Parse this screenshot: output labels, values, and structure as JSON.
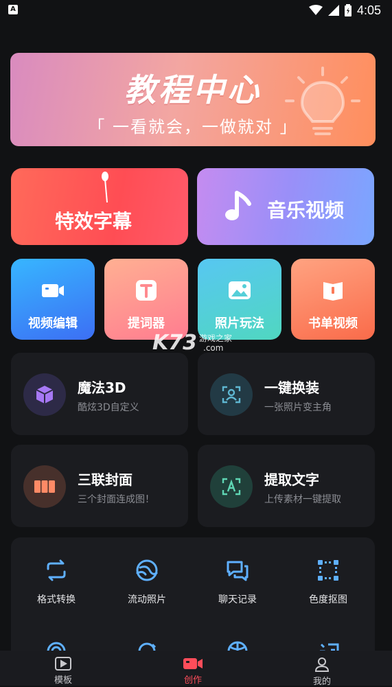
{
  "status_bar": {
    "time": "4:05",
    "app_badge": "A"
  },
  "banner": {
    "title": "教程中心",
    "subtitle": "「 一看就会，一做就对 」"
  },
  "big_cards": [
    {
      "label": "特效字幕"
    },
    {
      "label": "音乐视频"
    }
  ],
  "quick_cards": [
    {
      "label": "视频编辑",
      "icon": "video-camera-icon"
    },
    {
      "label": "提词器",
      "icon": "teleprompter-t-icon"
    },
    {
      "label": "照片玩法",
      "icon": "photo-icon"
    },
    {
      "label": "书单视频",
      "icon": "book-icon"
    }
  ],
  "feature_tiles": [
    {
      "title": "魔法3D",
      "subtitle": "酷炫3D自定义",
      "icon": "cube-icon",
      "accent": "#9a6cf0"
    },
    {
      "title": "一键换装",
      "subtitle": "一张照片变主角",
      "icon": "face-scan-icon",
      "accent": "#4fa6c2"
    },
    {
      "title": "三联封面",
      "subtitle": "三个封面连成图！",
      "icon": "triptych-icon",
      "accent": "#ff7a5a"
    },
    {
      "title": "提取文字",
      "subtitle": "上传素材一键提取",
      "icon": "text-scan-icon",
      "accent": "#5fd0b0"
    }
  ],
  "tools": [
    {
      "label": "格式转换",
      "icon": "convert-icon"
    },
    {
      "label": "流动照片",
      "icon": "flow-photo-icon"
    },
    {
      "label": "聊天记录",
      "icon": "chat-icon"
    },
    {
      "label": "色度抠图",
      "icon": "chroma-key-icon"
    }
  ],
  "watermark": {
    "brand": "K73",
    "site": "游戏之家",
    "domain": ".com"
  },
  "tabbar": [
    {
      "label": "模板",
      "active": false
    },
    {
      "label": "创作",
      "active": true
    },
    {
      "label": "我的",
      "active": false
    }
  ],
  "colors": {
    "accent": "#ff4d5a",
    "background": "#111214",
    "tile": "#1b1c20"
  }
}
